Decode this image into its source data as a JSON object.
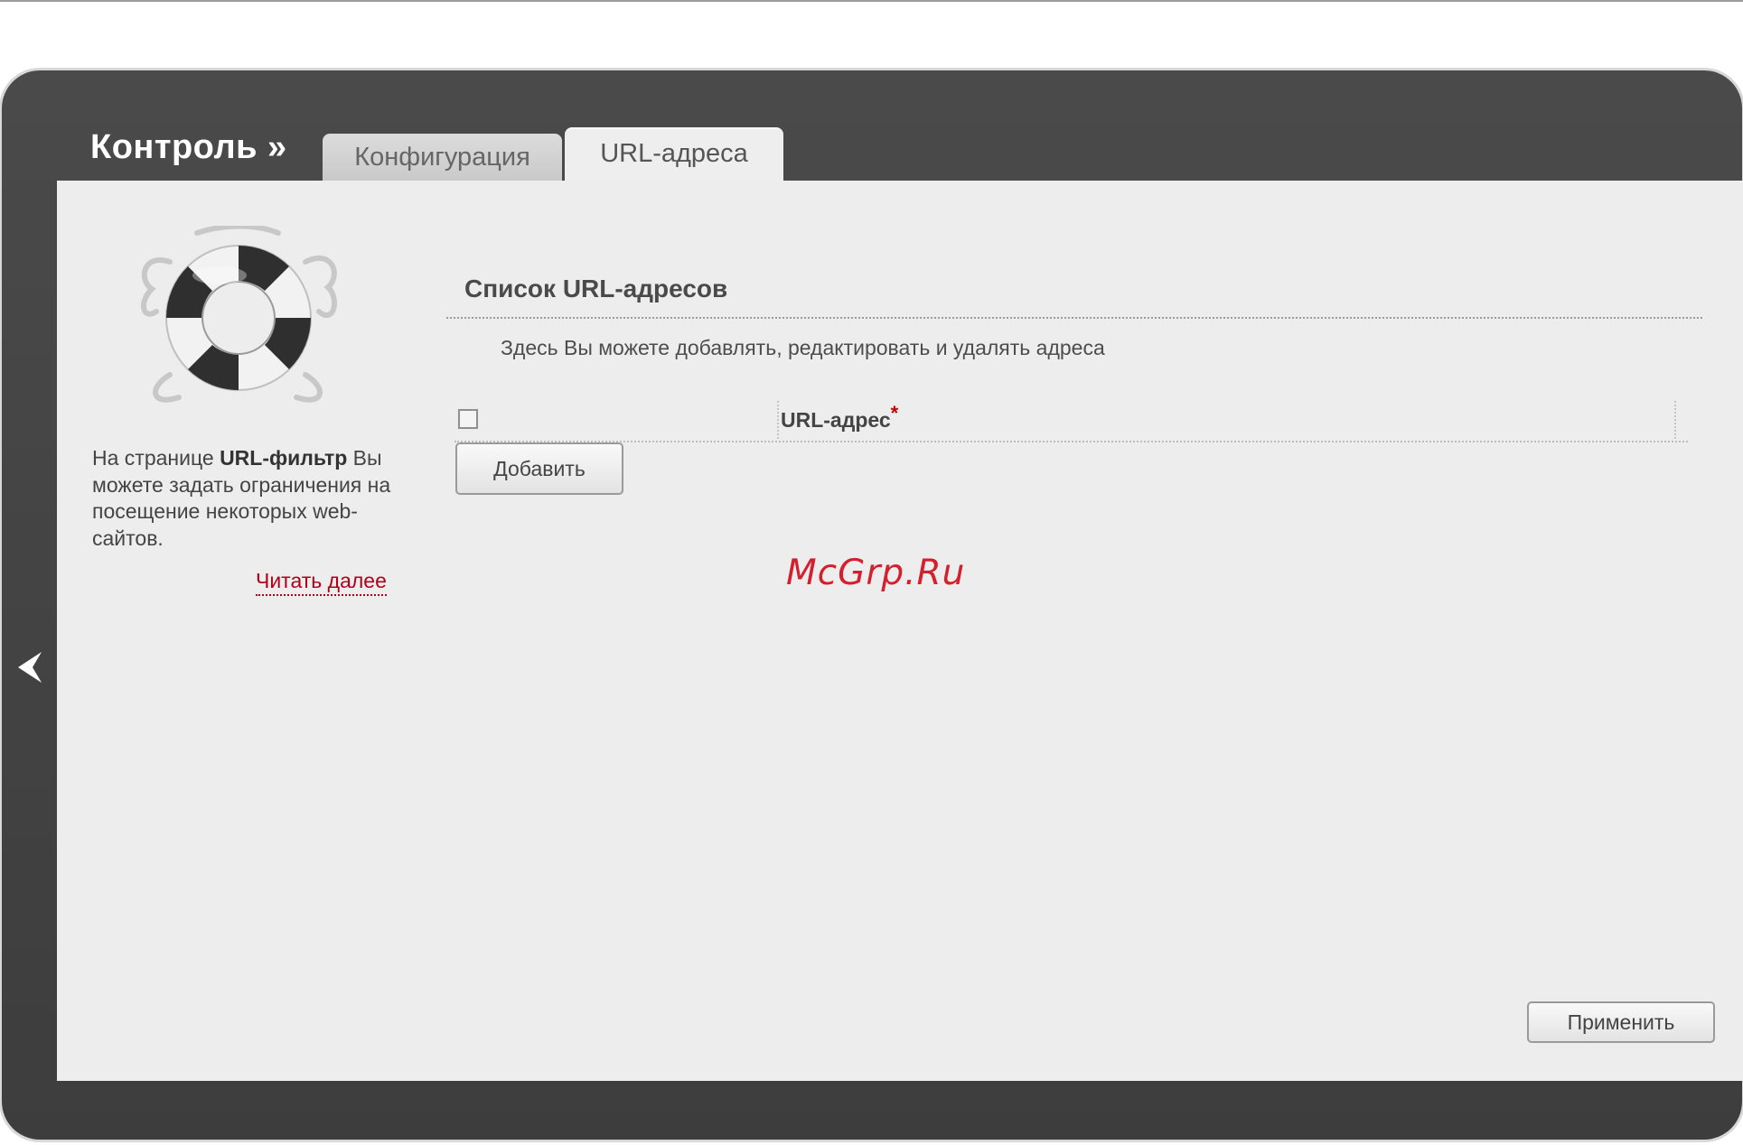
{
  "header": {
    "section_title": "Контроль »",
    "tabs": [
      {
        "label": "Конфигурация",
        "active": false
      },
      {
        "label": "URL-адреса",
        "active": true
      }
    ]
  },
  "sidebar": {
    "icon": "lifebuoy-icon",
    "help_prefix": "На странице ",
    "help_bold": "URL-фильтр",
    "help_suffix": " Вы можете задать ограничения на посещение некоторых web-сайтов.",
    "read_more": "Читать далее"
  },
  "main": {
    "list_title": "Список URL-адресов",
    "list_description": "Здесь Вы можете добавлять, редактировать и удалять адреса",
    "table": {
      "column_url": "URL-адрес",
      "required_mark": "*",
      "select_all_checked": false
    },
    "add_button": "Добавить",
    "apply_button": "Применить"
  },
  "watermark": "McGrp.Ru",
  "colors": {
    "frame": "#444444",
    "panel": "#ededed",
    "link": "#b0001a",
    "required": "#cc0000",
    "watermark": "#d2202f"
  }
}
